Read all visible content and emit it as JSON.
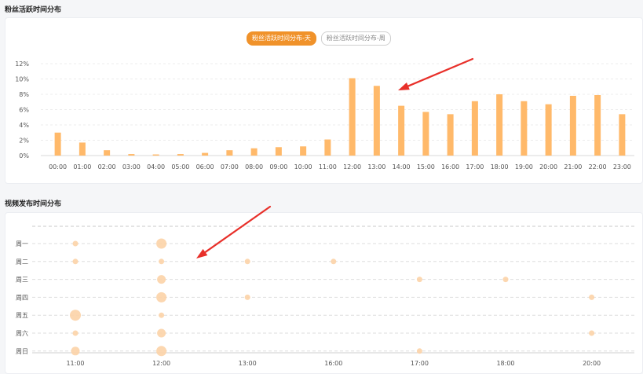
{
  "sections": {
    "fans_title": "粉丝活跃时间分布",
    "video_title": "视频发布时间分布"
  },
  "tabs": [
    {
      "label": "粉丝活跃时间分布-天",
      "active": true
    },
    {
      "label": "粉丝活跃时间分布-周",
      "active": false
    }
  ],
  "colors": {
    "bar": "#ffb96a",
    "dot": "#fcd3a7",
    "accent": "#f0922a",
    "arrow": "#e8302a"
  },
  "chart_data": [
    {
      "type": "bar",
      "categories": [
        "00:00",
        "01:00",
        "02:00",
        "03:00",
        "04:00",
        "05:00",
        "06:00",
        "07:00",
        "08:00",
        "09:00",
        "10:00",
        "11:00",
        "12:00",
        "13:00",
        "14:00",
        "15:00",
        "16:00",
        "17:00",
        "18:00",
        "19:00",
        "20:00",
        "21:00",
        "22:00",
        "23:00"
      ],
      "values": [
        3.0,
        1.7,
        0.7,
        0.2,
        0.15,
        0.2,
        0.35,
        0.7,
        0.95,
        1.1,
        1.2,
        2.1,
        10.1,
        9.1,
        6.5,
        5.7,
        5.4,
        7.1,
        8.0,
        7.1,
        6.7,
        7.8,
        7.9,
        5.4
      ],
      "y_ticks": [
        "0%",
        "2%",
        "4%",
        "6%",
        "8%",
        "10%",
        "12%"
      ],
      "ylim": [
        0,
        12
      ],
      "grid": true
    },
    {
      "type": "scatter",
      "x_ticks": [
        "11:00",
        "12:00",
        "13:00",
        "16:00",
        "17:00",
        "18:00",
        "20:00"
      ],
      "y_categories": [
        "周一",
        "周二",
        "周三",
        "周四",
        "周五",
        "周六",
        "周日"
      ],
      "points": [
        {
          "x": "11:00",
          "y": "周一",
          "size": 1
        },
        {
          "x": "12:00",
          "y": "周一",
          "size": 3
        },
        {
          "x": "11:00",
          "y": "周二",
          "size": 1
        },
        {
          "x": "12:00",
          "y": "周二",
          "size": 1
        },
        {
          "x": "13:00",
          "y": "周二",
          "size": 1
        },
        {
          "x": "16:00",
          "y": "周二",
          "size": 1
        },
        {
          "x": "12:00",
          "y": "周三",
          "size": 2
        },
        {
          "x": "17:00",
          "y": "周三",
          "size": 1
        },
        {
          "x": "18:00",
          "y": "周三",
          "size": 1
        },
        {
          "x": "12:00",
          "y": "周四",
          "size": 3
        },
        {
          "x": "13:00",
          "y": "周四",
          "size": 1
        },
        {
          "x": "20:00",
          "y": "周四",
          "size": 1
        },
        {
          "x": "11:00",
          "y": "周五",
          "size": 4
        },
        {
          "x": "12:00",
          "y": "周五",
          "size": 1
        },
        {
          "x": "11:00",
          "y": "周六",
          "size": 1
        },
        {
          "x": "12:00",
          "y": "周六",
          "size": 2
        },
        {
          "x": "20:00",
          "y": "周六",
          "size": 1
        },
        {
          "x": "11:00",
          "y": "周日",
          "size": 2
        },
        {
          "x": "12:00",
          "y": "周日",
          "size": 3
        },
        {
          "x": "17:00",
          "y": "周日",
          "size": 1
        }
      ],
      "grid": true
    }
  ]
}
